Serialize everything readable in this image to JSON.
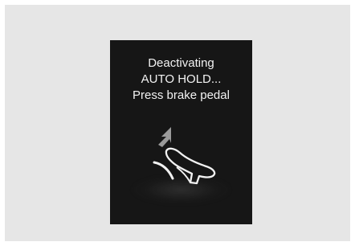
{
  "cluster_message": {
    "lines": [
      "Deactivating",
      "AUTO HOLD...",
      "Press brake pedal"
    ]
  },
  "icons": {
    "illustration": "foot-pressing-brake-pedal-icon"
  },
  "colors": {
    "background": "#e6e6e6",
    "display": "#161616",
    "text": "#f2f2f2",
    "arrow": "#9a9a9a"
  }
}
